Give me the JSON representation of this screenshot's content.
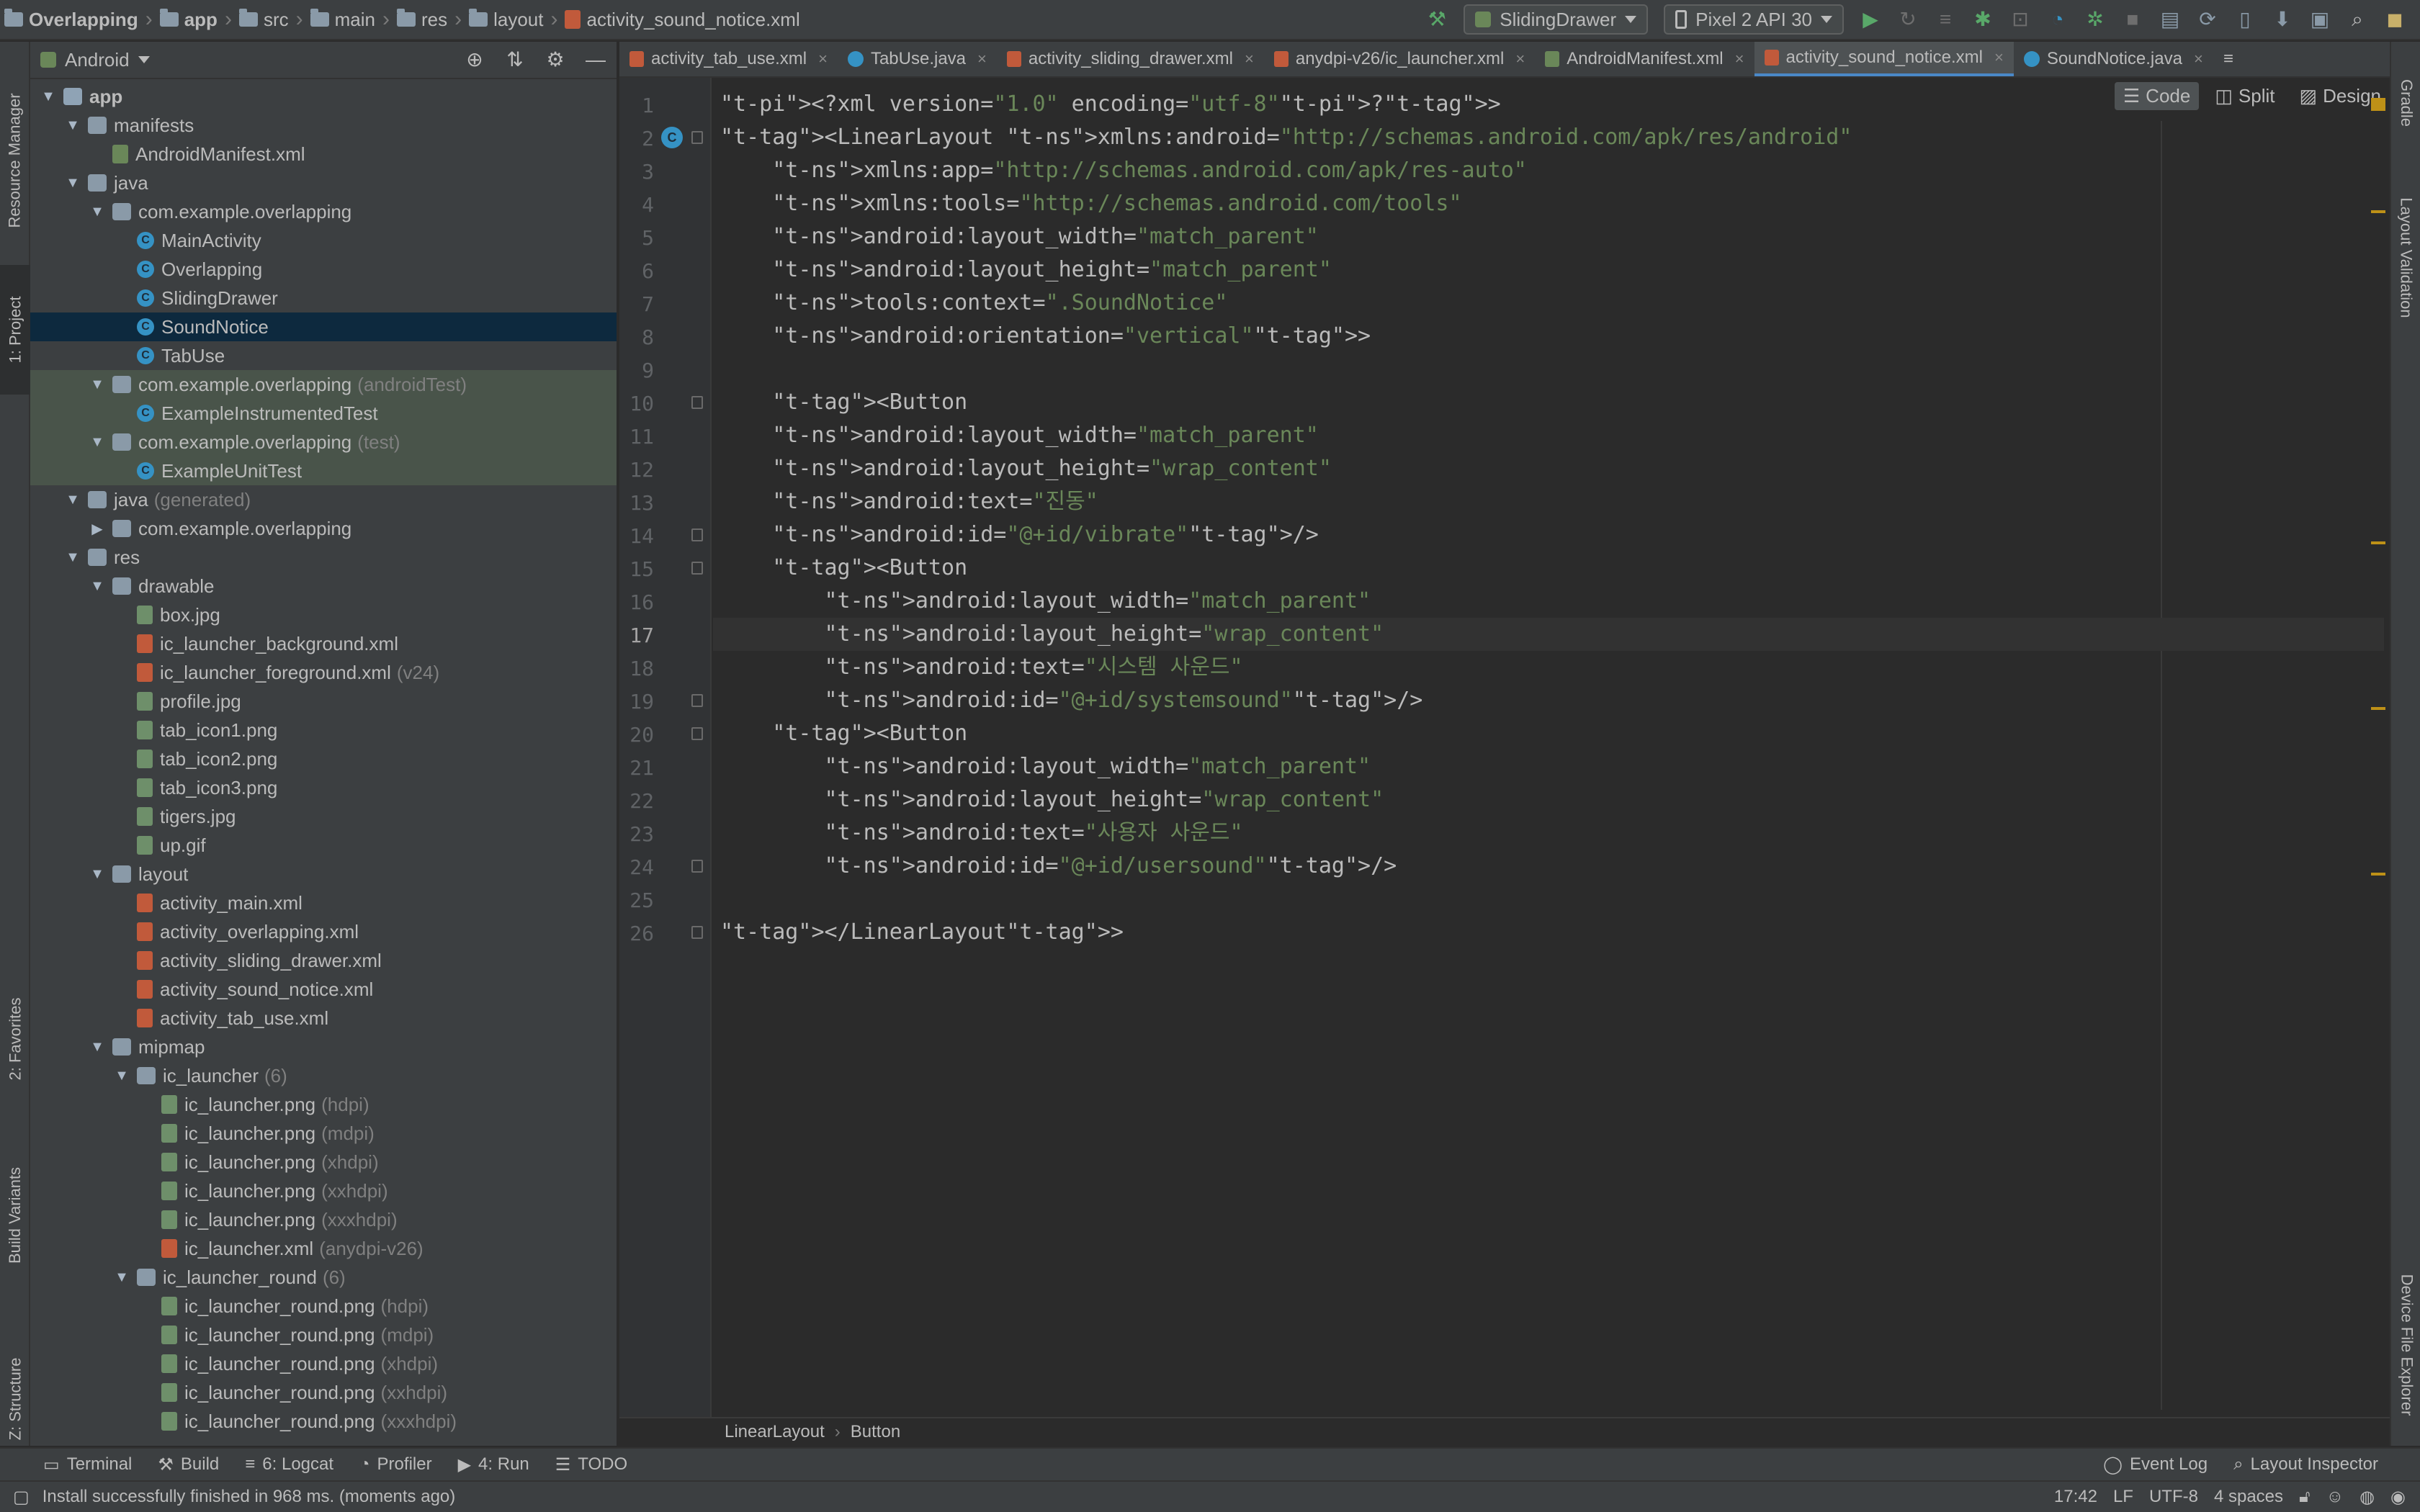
{
  "nav": {
    "breadcrumbs": [
      "Overlapping",
      "app",
      "src",
      "main",
      "res",
      "layout",
      "activity_sound_notice.xml"
    ],
    "run_config": "SlidingDrawer",
    "device": "Pixel 2 API 30"
  },
  "left_strip": {
    "tabs": [
      "Resource Manager",
      "1: Project",
      "2: Favorites",
      "Build Variants",
      "Z: Structure"
    ]
  },
  "right_strip": {
    "tabs": [
      "Gradle",
      "Layout Validation",
      "Device File Explorer"
    ]
  },
  "project": {
    "view_selector": "Android",
    "tree": [
      {
        "label": "app",
        "suffix": "",
        "depth": 0,
        "arrow": "down",
        "icon": "module-icon",
        "state": ""
      },
      {
        "label": "manifests",
        "suffix": "",
        "depth": 1,
        "arrow": "down",
        "icon": "folder-icon",
        "state": ""
      },
      {
        "label": "AndroidManifest.xml",
        "suffix": "",
        "depth": 2,
        "arrow": "",
        "icon": "manifest-file-icon",
        "state": ""
      },
      {
        "label": "java",
        "suffix": "",
        "depth": 1,
        "arrow": "down",
        "icon": "folder-icon",
        "state": ""
      },
      {
        "label": "com.example.overlapping",
        "suffix": "",
        "depth": 2,
        "arrow": "down",
        "icon": "package-icon",
        "state": ""
      },
      {
        "label": "MainActivity",
        "suffix": "",
        "depth": 3,
        "arrow": "",
        "icon": "class-icon",
        "state": ""
      },
      {
        "label": "Overlapping",
        "suffix": "",
        "depth": 3,
        "arrow": "",
        "icon": "class-icon",
        "state": ""
      },
      {
        "label": "SlidingDrawer",
        "suffix": "",
        "depth": 3,
        "arrow": "",
        "icon": "class-icon",
        "state": ""
      },
      {
        "label": "SoundNotice",
        "suffix": "",
        "depth": 3,
        "arrow": "",
        "icon": "class-icon",
        "state": "selected"
      },
      {
        "label": "TabUse",
        "suffix": "",
        "depth": 3,
        "arrow": "",
        "icon": "class-icon",
        "state": ""
      },
      {
        "label": "com.example.overlapping",
        "suffix": "(androidTest)",
        "depth": 2,
        "arrow": "down",
        "icon": "package-icon",
        "state": "test"
      },
      {
        "label": "ExampleInstrumentedTest",
        "suffix": "",
        "depth": 3,
        "arrow": "",
        "icon": "class-icon",
        "state": "test"
      },
      {
        "label": "com.example.overlapping",
        "suffix": "(test)",
        "depth": 2,
        "arrow": "down",
        "icon": "package-icon",
        "state": "test"
      },
      {
        "label": "ExampleUnitTest",
        "suffix": "",
        "depth": 3,
        "arrow": "",
        "icon": "class-icon",
        "state": "test"
      },
      {
        "label": "java",
        "suffix": "(generated)",
        "depth": 1,
        "arrow": "down",
        "icon": "folder-icon",
        "state": ""
      },
      {
        "label": "com.example.overlapping",
        "suffix": "",
        "depth": 2,
        "arrow": "right",
        "icon": "package-icon",
        "state": ""
      },
      {
        "label": "res",
        "suffix": "",
        "depth": 1,
        "arrow": "down",
        "icon": "folder-icon",
        "state": ""
      },
      {
        "label": "drawable",
        "suffix": "",
        "depth": 2,
        "arrow": "down",
        "icon": "folder-icon",
        "state": ""
      },
      {
        "label": "box.jpg",
        "suffix": "",
        "depth": 3,
        "arrow": "",
        "icon": "image-file-icon",
        "state": ""
      },
      {
        "label": "ic_launcher_background.xml",
        "suffix": "",
        "depth": 3,
        "arrow": "",
        "icon": "xml-file-icon",
        "state": ""
      },
      {
        "label": "ic_launcher_foreground.xml",
        "suffix": "(v24)",
        "depth": 3,
        "arrow": "",
        "icon": "xml-file-icon",
        "state": ""
      },
      {
        "label": "profile.jpg",
        "suffix": "",
        "depth": 3,
        "arrow": "",
        "icon": "image-file-icon",
        "state": ""
      },
      {
        "label": "tab_icon1.png",
        "suffix": "",
        "depth": 3,
        "arrow": "",
        "icon": "image-file-icon",
        "state": ""
      },
      {
        "label": "tab_icon2.png",
        "suffix": "",
        "depth": 3,
        "arrow": "",
        "icon": "image-file-icon",
        "state": ""
      },
      {
        "label": "tab_icon3.png",
        "suffix": "",
        "depth": 3,
        "arrow": "",
        "icon": "image-file-icon",
        "state": ""
      },
      {
        "label": "tigers.jpg",
        "suffix": "",
        "depth": 3,
        "arrow": "",
        "icon": "image-file-icon",
        "state": ""
      },
      {
        "label": "up.gif",
        "suffix": "",
        "depth": 3,
        "arrow": "",
        "icon": "image-file-icon",
        "state": ""
      },
      {
        "label": "layout",
        "suffix": "",
        "depth": 2,
        "arrow": "down",
        "icon": "folder-icon",
        "state": ""
      },
      {
        "label": "activity_main.xml",
        "suffix": "",
        "depth": 3,
        "arrow": "",
        "icon": "xml-file-icon",
        "state": ""
      },
      {
        "label": "activity_overlapping.xml",
        "suffix": "",
        "depth": 3,
        "arrow": "",
        "icon": "xml-file-icon",
        "state": ""
      },
      {
        "label": "activity_sliding_drawer.xml",
        "suffix": "",
        "depth": 3,
        "arrow": "",
        "icon": "xml-file-icon",
        "state": ""
      },
      {
        "label": "activity_sound_notice.xml",
        "suffix": "",
        "depth": 3,
        "arrow": "",
        "icon": "xml-file-icon",
        "state": ""
      },
      {
        "label": "activity_tab_use.xml",
        "suffix": "",
        "depth": 3,
        "arrow": "",
        "icon": "xml-file-icon",
        "state": ""
      },
      {
        "label": "mipmap",
        "suffix": "",
        "depth": 2,
        "arrow": "down",
        "icon": "folder-icon",
        "state": ""
      },
      {
        "label": "ic_launcher",
        "suffix": "(6)",
        "depth": 3,
        "arrow": "down",
        "icon": "folder-icon",
        "state": ""
      },
      {
        "label": "ic_launcher.png",
        "suffix": "(hdpi)",
        "depth": 4,
        "arrow": "",
        "icon": "image-file-icon",
        "state": ""
      },
      {
        "label": "ic_launcher.png",
        "suffix": "(mdpi)",
        "depth": 4,
        "arrow": "",
        "icon": "image-file-icon",
        "state": ""
      },
      {
        "label": "ic_launcher.png",
        "suffix": "(xhdpi)",
        "depth": 4,
        "arrow": "",
        "icon": "image-file-icon",
        "state": ""
      },
      {
        "label": "ic_launcher.png",
        "suffix": "(xxhdpi)",
        "depth": 4,
        "arrow": "",
        "icon": "image-file-icon",
        "state": ""
      },
      {
        "label": "ic_launcher.png",
        "suffix": "(xxxhdpi)",
        "depth": 4,
        "arrow": "",
        "icon": "image-file-icon",
        "state": ""
      },
      {
        "label": "ic_launcher.xml",
        "suffix": "(anydpi-v26)",
        "depth": 4,
        "arrow": "",
        "icon": "xml-file-icon",
        "state": ""
      },
      {
        "label": "ic_launcher_round",
        "suffix": "(6)",
        "depth": 3,
        "arrow": "down",
        "icon": "folder-icon",
        "state": ""
      },
      {
        "label": "ic_launcher_round.png",
        "suffix": "(hdpi)",
        "depth": 4,
        "arrow": "",
        "icon": "image-file-icon",
        "state": ""
      },
      {
        "label": "ic_launcher_round.png",
        "suffix": "(mdpi)",
        "depth": 4,
        "arrow": "",
        "icon": "image-file-icon",
        "state": ""
      },
      {
        "label": "ic_launcher_round.png",
        "suffix": "(xhdpi)",
        "depth": 4,
        "arrow": "",
        "icon": "image-file-icon",
        "state": ""
      },
      {
        "label": "ic_launcher_round.png",
        "suffix": "(xxhdpi)",
        "depth": 4,
        "arrow": "",
        "icon": "image-file-icon",
        "state": ""
      },
      {
        "label": "ic_launcher_round.png",
        "suffix": "(xxxhdpi)",
        "depth": 4,
        "arrow": "",
        "icon": "image-file-icon",
        "state": ""
      }
    ]
  },
  "editor_tabs": [
    {
      "label": "activity_tab_use.xml",
      "icon": "xml-file-icon",
      "active": false
    },
    {
      "label": "TabUse.java",
      "icon": "class-icon",
      "active": false
    },
    {
      "label": "activity_sliding_drawer.xml",
      "icon": "xml-file-icon",
      "active": false
    },
    {
      "label": "anydpi-v26/ic_launcher.xml",
      "icon": "xml-file-icon",
      "active": false
    },
    {
      "label": "AndroidManifest.xml",
      "icon": "manifest-file-icon",
      "active": false
    },
    {
      "label": "activity_sound_notice.xml",
      "icon": "xml-file-icon",
      "active": true
    },
    {
      "label": "SoundNotice.java",
      "icon": "class-icon",
      "active": false
    }
  ],
  "editor_modes": [
    "Code",
    "Split",
    "Design"
  ],
  "code": {
    "current_line": 17,
    "lines": [
      "<?xml version=\"1.0\" encoding=\"utf-8\"?>",
      "<LinearLayout xmlns:android=\"http://schemas.android.com/apk/res/android\"",
      "    xmlns:app=\"http://schemas.android.com/apk/res-auto\"",
      "    xmlns:tools=\"http://schemas.android.com/tools\"",
      "    android:layout_width=\"match_parent\"",
      "    android:layout_height=\"match_parent\"",
      "    tools:context=\".SoundNotice\"",
      "    android:orientation=\"vertical\">",
      "",
      "    <Button",
      "    android:layout_width=\"match_parent\"",
      "    android:layout_height=\"wrap_content\"",
      "    android:text=\"진동\"",
      "    android:id=\"@+id/vibrate\"/>",
      "    <Button",
      "        android:layout_width=\"match_parent\"",
      "        android:layout_height=\"wrap_content\"",
      "        android:text=\"시스템 사운드\"",
      "        android:id=\"@+id/systemsound\"/>",
      "    <Button",
      "        android:layout_width=\"match_parent\"",
      "        android:layout_height=\"wrap_content\"",
      "        android:text=\"사용자 사운드\"",
      "        android:id=\"@+id/usersound\"/>",
      "",
      "</LinearLayout>"
    ]
  },
  "editor_breadcrumb": [
    "LinearLayout",
    "Button"
  ],
  "bottom_tools": {
    "left": [
      "Terminal",
      "Build",
      "6: Logcat",
      "Profiler",
      "4: Run",
      "TODO"
    ],
    "right": [
      "Event Log",
      "Layout Inspector"
    ]
  },
  "status": {
    "message": "Install successfully finished in 968 ms. (moments ago)",
    "position": "17:42",
    "line_separator": "LF",
    "encoding": "UTF-8",
    "indent": "4 spaces"
  },
  "colors": {
    "tag": "#e8bf6a",
    "namespace": "#9876aa",
    "string": "#6a8759",
    "selection": "#0d293e",
    "accent": "#4a88c7"
  }
}
